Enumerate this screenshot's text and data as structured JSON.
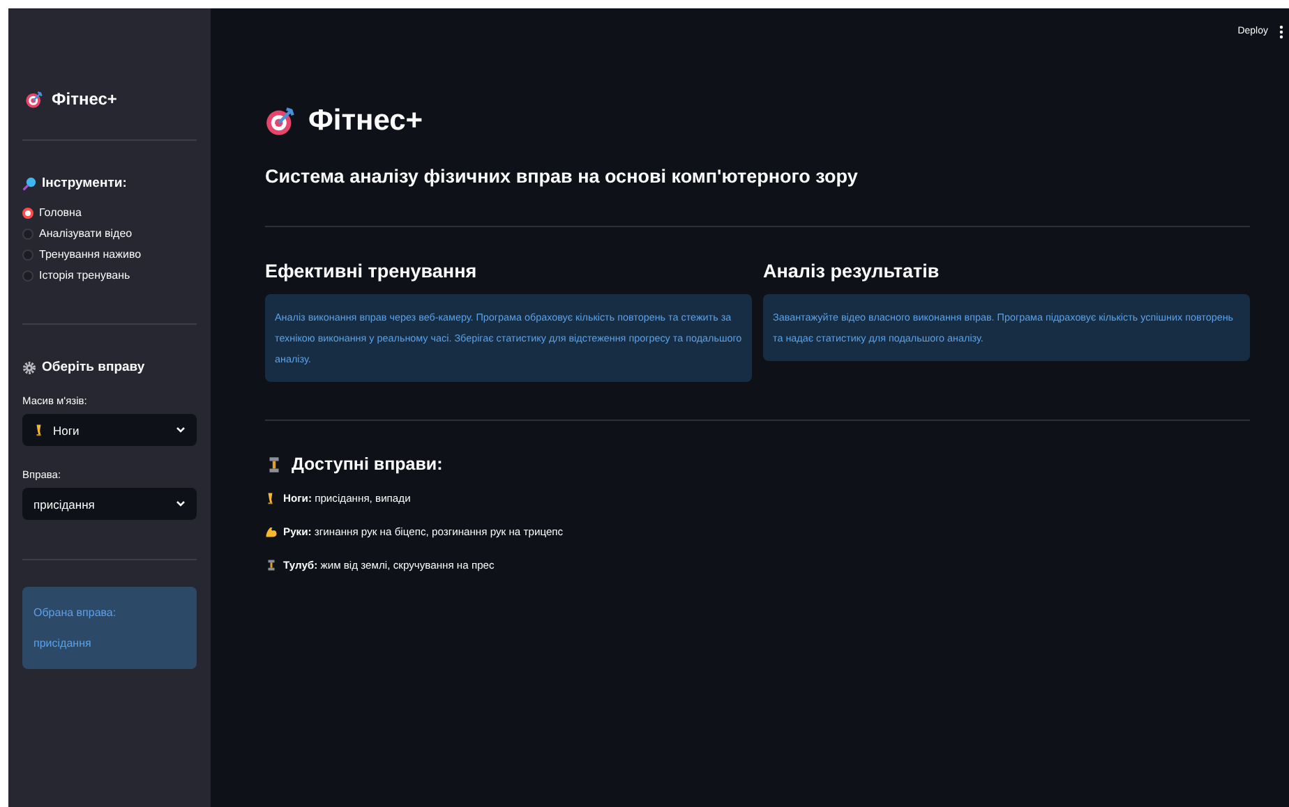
{
  "header": {
    "deploy": "Deploy"
  },
  "sidebar": {
    "title": "Фітнес+",
    "tools_heading": "Інструменти:",
    "nav": [
      {
        "label": "Головна",
        "selected": true
      },
      {
        "label": "Аналізувати відео",
        "selected": false
      },
      {
        "label": "Тренування наживо",
        "selected": false
      },
      {
        "label": "Історія тренувань",
        "selected": false
      }
    ],
    "exercise_heading": "Оберіть вправу",
    "selects": [
      {
        "label": "Масив м'язів:",
        "value": "Ноги",
        "kind": "leg"
      },
      {
        "label": "Вправа:",
        "value": "присідання"
      }
    ],
    "selected_card": {
      "heading": "Обрана вправа:",
      "value": "присідання"
    }
  },
  "main": {
    "title": "Фітнес+",
    "subtitle": "Система аналізу фізичних вправ на основі комп'ютерного зору",
    "features": [
      {
        "title": "Ефективні тренування",
        "text": "Аналіз виконання вправ через веб-камеру. Програма обраховує кількість повторень та стежить за технікою виконання у реальному часі. Зберігає статистику для відстеження прогресу та подальшого аналізу."
      },
      {
        "title": "Аналіз результатів",
        "text": "Завантажуйте відео власного виконання вправ. Програма підраховує кількість успішних повторень та надає статистику для подальшого аналізу."
      }
    ],
    "exercises_heading": "Доступні вправи:",
    "groups": [
      {
        "kind": "leg",
        "text": "**Ноги:** присідання, випади"
      },
      {
        "kind": "arm",
        "text": "**Руки:** згинання рук на біцепс, розгинання рук на трицепс"
      },
      {
        "kind": "dumbbell",
        "text": "**Тулуб:** жим від землі, скручування на прес"
      }
    ]
  }
}
